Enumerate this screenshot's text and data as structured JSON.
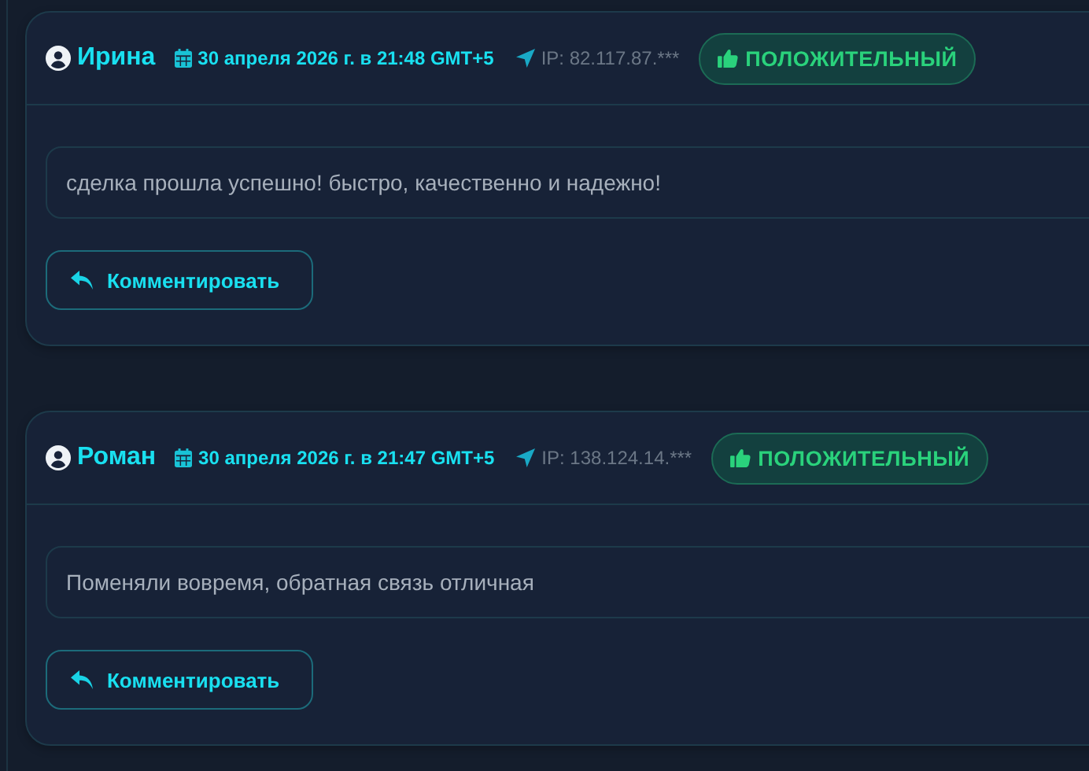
{
  "reviews": [
    {
      "author": "Ирина",
      "date": "30 апреля 2026 г. в 21:48 GMT+5",
      "ip": "IP: 82.117.87.***",
      "rating": {
        "kind": "positive",
        "label": "ПОЛОЖИТЕЛЬНЫЙ"
      },
      "text": "сделка прошла успешно! быстро, качественно и надежно!",
      "comment_button": "Комментировать"
    },
    {
      "author": "Роман",
      "date": "30 апреля 2026 г. в 21:47 GMT+5",
      "ip": "IP: 138.124.14.***",
      "rating": {
        "kind": "positive",
        "label": "ПОЛОЖИТЕЛЬНЫЙ"
      },
      "text": "Поменяли вовремя, обратная связь отличная",
      "comment_button": "Комментировать"
    }
  ]
}
